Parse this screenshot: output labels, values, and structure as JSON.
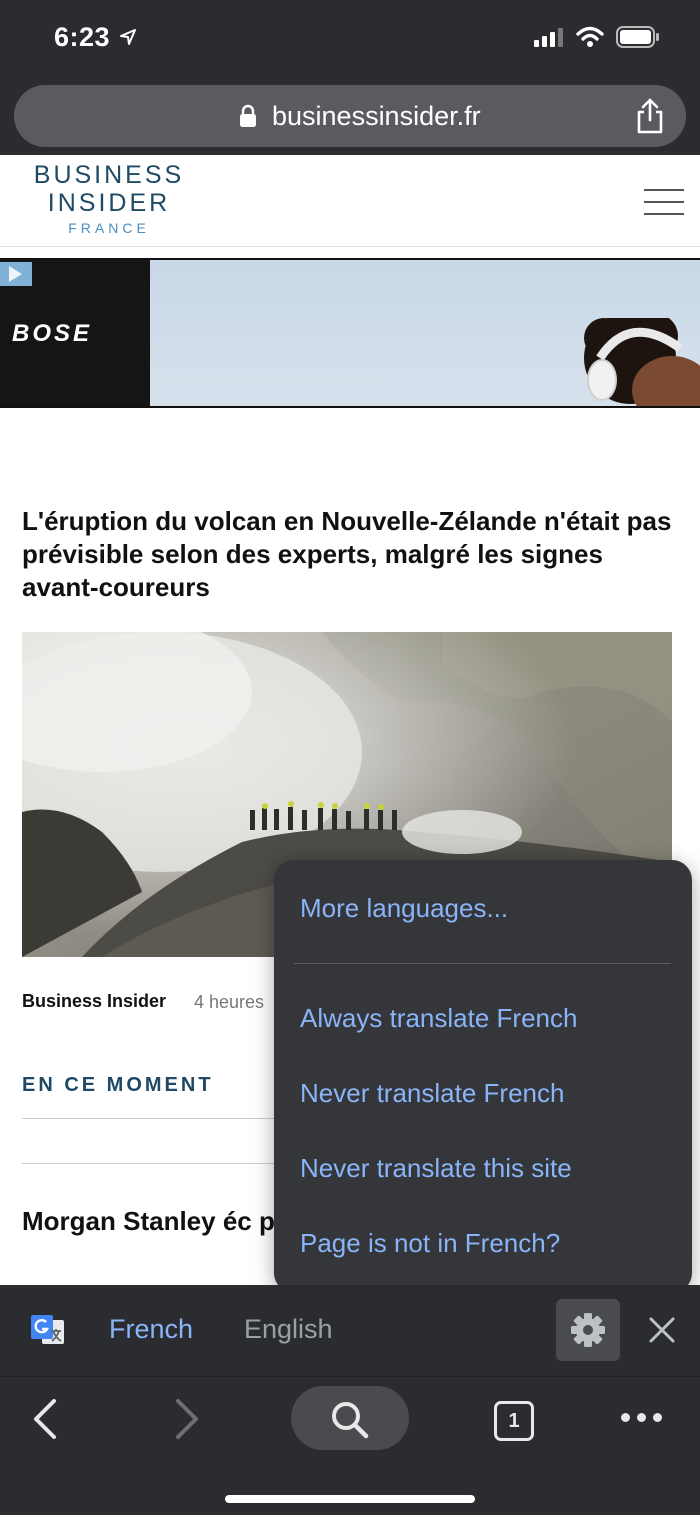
{
  "status_bar": {
    "time": "6:23"
  },
  "address_bar": {
    "url": "businessinsider.fr"
  },
  "site": {
    "logo_line1": "BUSINESS",
    "logo_line2": "INSIDER",
    "logo_line3": "FRANCE"
  },
  "ad": {
    "brand": "BOSE"
  },
  "article": {
    "headline": "L'éruption du volcan en Nouvelle-Zélande n'était pas prévisible selon des experts, malgré les signes avant-coureurs",
    "source": "Business Insider",
    "time": "4 heures"
  },
  "section": {
    "label": "EN CE MOMENT"
  },
  "second_article": {
    "headline": "Morgan Stanley éc pour avoir manipule"
  },
  "translate_menu": {
    "more_languages": "More languages...",
    "always_translate": "Always translate French",
    "never_translate_lang": "Never translate French",
    "never_translate_site": "Never translate this site",
    "page_not_in": "Page is not in French?"
  },
  "translate_bar": {
    "source_lang": "French",
    "target_lang": "English"
  },
  "toolbar": {
    "tab_count": "1"
  },
  "colors": {
    "accent_blue": "#8ab4f8",
    "chrome_dark": "#2b2c30",
    "menu_bg": "#35363a",
    "logo_navy": "#1f4a63"
  }
}
